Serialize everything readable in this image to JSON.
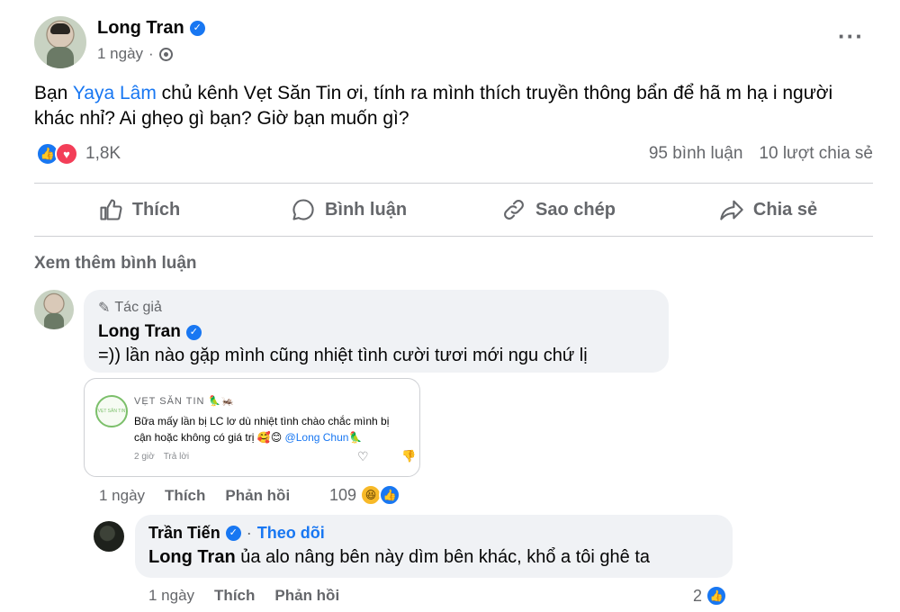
{
  "post": {
    "author": "Long Tran",
    "time": "1 ngày",
    "text_before": "Bạn ",
    "mention": "Yaya Lâm",
    "text_after": " chủ kênh Vẹt Săn Tin ơi, tính ra mình thích truyền thông bẩn để hã m hạ i người khác nhỉ? Ai ghẹo gì bạn? Giờ bạn muốn gì?",
    "reaction_count": "1,8K",
    "comments_count": "95 bình luận",
    "shares_count": "10 lượt chia sẻ"
  },
  "actions": {
    "like": "Thích",
    "comment": "Bình luận",
    "copy": "Sao chép",
    "share": "Chia sẻ"
  },
  "see_more": "Xem thêm bình luận",
  "comment1": {
    "author_tag": "Tác giả",
    "author": "Long Tran",
    "text": "=)) lần nào gặp mình cũng nhiệt tình cười tươi mới ngu chứ lị",
    "time": "1 ngày",
    "like": "Thích",
    "reply": "Phản hồi",
    "reaction_count": "109",
    "screenshot": {
      "name": "VẸT SĂN TIN 🦜🦗",
      "avatar_text": "VẸT SĂN TIN",
      "text": "Bữa mấy lần bị LC lơ dù nhiệt tình chào chắc mình bị cận hoặc không có giá trị 🥰😊 ",
      "mention": "@Long Chun🦜",
      "time": "2 giờ",
      "reply": "Trả lời"
    }
  },
  "comment2": {
    "author": "Trần Tiến",
    "follow": "Theo dõi",
    "ref": "Long Tran",
    "text": " ủa alo nâng bên này dìm bên khác, khổ a tôi ghê ta",
    "time": "1 ngày",
    "like": "Thích",
    "reply": "Phản hồi",
    "reaction_count": "2"
  },
  "colors": {
    "accent": "#1877f2",
    "love": "#f33e58",
    "muted": "#65676b",
    "bubble": "#f0f2f5"
  },
  "icons": [
    "globe-icon",
    "more-icon",
    "like-icon",
    "love-icon",
    "comment-icon",
    "copy-icon",
    "share-icon",
    "pen-icon",
    "haha-icon",
    "verified-icon"
  ]
}
